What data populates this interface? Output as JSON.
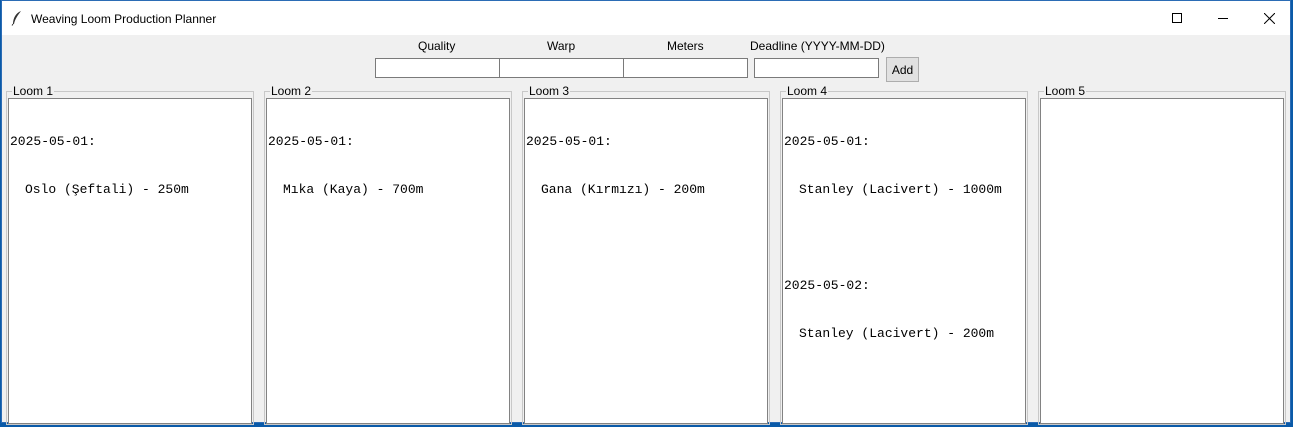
{
  "window": {
    "title": "Weaving Loom Production Planner"
  },
  "form": {
    "quality_label": "Quality",
    "warp_label": "Warp",
    "meters_label": "Meters",
    "deadline_label": "Deadline (YYYY-MM-DD)",
    "quality_value": "",
    "warp_value": "",
    "meters_value": "",
    "deadline_value": "",
    "add_label": "Add"
  },
  "looms": [
    {
      "title": "Loom 1",
      "schedule": [
        {
          "date": "2025-05-01:",
          "entries": [
            "Oslo (Şeftali) - 250m"
          ]
        }
      ]
    },
    {
      "title": "Loom 2",
      "schedule": [
        {
          "date": "2025-05-01:",
          "entries": [
            "Mıka (Kaya) - 700m"
          ]
        }
      ]
    },
    {
      "title": "Loom 3",
      "schedule": [
        {
          "date": "2025-05-01:",
          "entries": [
            "Gana (Kırmızı) - 200m"
          ]
        }
      ]
    },
    {
      "title": "Loom 4",
      "schedule": [
        {
          "date": "2025-05-01:",
          "entries": [
            "Stanley (Lacivert) - 1000m"
          ]
        },
        {
          "date": "2025-05-02:",
          "entries": [
            "Stanley (Lacivert) - 200m"
          ]
        }
      ]
    },
    {
      "title": "Loom 5",
      "schedule": []
    }
  ]
}
